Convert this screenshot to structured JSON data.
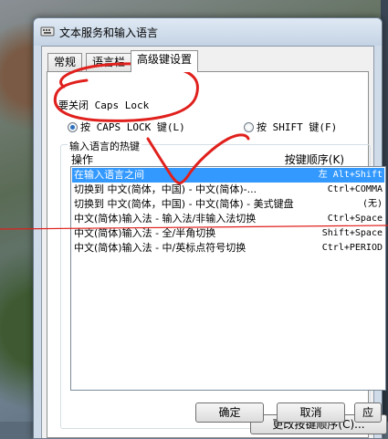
{
  "window": {
    "title": "文本服务和输入语言"
  },
  "tabs": [
    {
      "label": "常规"
    },
    {
      "label": "语言栏"
    },
    {
      "label": "高级键设置"
    }
  ],
  "caps_group": {
    "label": "要关闭 Caps Lock",
    "options": [
      {
        "label": "按 CAPS LOCK 键(L)",
        "selected": true
      },
      {
        "label": "按 SHIFT 键(F)",
        "selected": false
      }
    ]
  },
  "hotkey_group": {
    "label": "输入语言的热键",
    "col_action": "操作",
    "col_key": "按键顺序(K)",
    "rows": [
      {
        "action": "在输入语言之间",
        "key": "左 Alt+Shift",
        "selected": true
      },
      {
        "action": "切换到 中文(简体，中国) - 中文(简体)-...",
        "key": "Ctrl+COMMA",
        "selected": false
      },
      {
        "action": "切换到 中文(简体，中国) - 中文(简体) - 美式键盘",
        "key": "(无)",
        "selected": false
      },
      {
        "action": "中文(简体)输入法 - 输入法/非输入法切换",
        "key": "Ctrl+Space",
        "selected": false
      },
      {
        "action": "中文(简体)输入法 - 全/半角切换",
        "key": "Shift+Space",
        "selected": false
      },
      {
        "action": "中文(简体)输入法 - 中/英标点符号切换",
        "key": "Ctrl+PERIOD",
        "selected": false
      }
    ]
  },
  "buttons": {
    "change": "更改按键顺序(C)...",
    "ok": "确定",
    "cancel": "取消",
    "apply": "应"
  },
  "colors": {
    "annotation": "#e0201c",
    "selection": "#3399ff"
  }
}
